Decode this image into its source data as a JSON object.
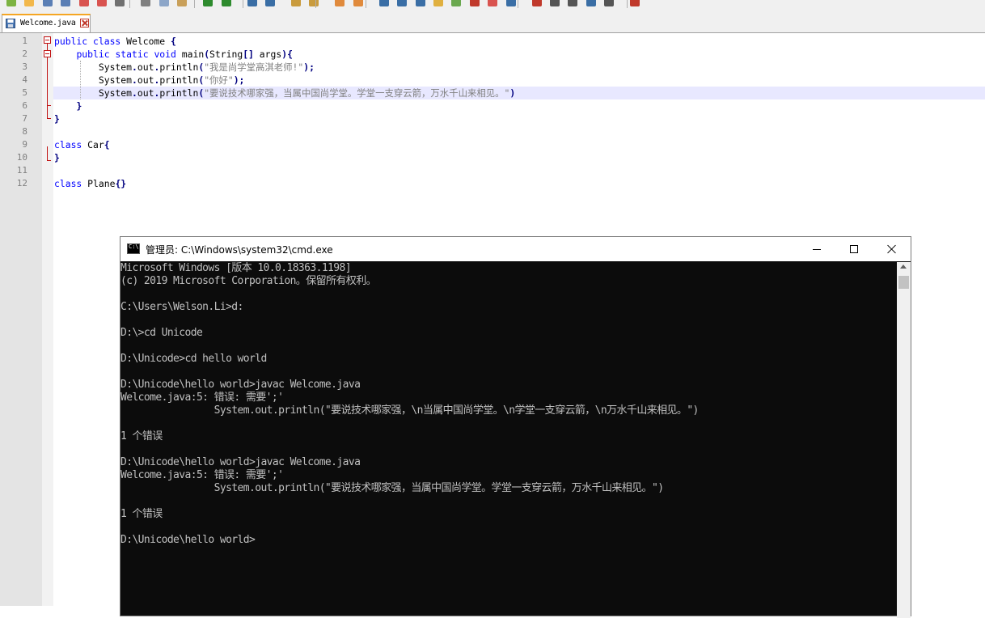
{
  "toolbar": {
    "buttons": [
      {
        "name": "new-file-icon",
        "color": "#7cb342"
      },
      {
        "name": "open-file-icon",
        "color": "#f2b84b"
      },
      {
        "name": "save-file-icon",
        "color": "#5b7fb5"
      },
      {
        "name": "save-all-icon",
        "color": "#5b7fb5"
      },
      {
        "name": "close-file-icon",
        "color": "#d9534f"
      },
      {
        "name": "close-all-icon",
        "color": "#d9534f"
      },
      {
        "name": "print-icon",
        "color": "#707070"
      },
      {
        "name": "cut-icon",
        "color": "#808080"
      },
      {
        "name": "copy-icon",
        "color": "#8da6c8"
      },
      {
        "name": "paste-icon",
        "color": "#c9a05a"
      },
      {
        "name": "undo-icon",
        "color": "#2e8b2e"
      },
      {
        "name": "redo-icon",
        "color": "#2e8b2e"
      },
      {
        "name": "find-icon",
        "color": "#3a6ea5"
      },
      {
        "name": "replace-icon",
        "color": "#3a6ea5"
      },
      {
        "name": "zoom-in-icon",
        "color": "#c99b3d"
      },
      {
        "name": "zoom-out-icon",
        "color": "#c99b3d"
      },
      {
        "name": "sync-v-icon",
        "color": "#e08a3c"
      },
      {
        "name": "sync-h-icon",
        "color": "#e08a3c"
      },
      {
        "name": "wrap-icon",
        "color": "#3a6ea5"
      },
      {
        "name": "all-chars-icon",
        "color": "#3a6ea5"
      },
      {
        "name": "indent-guide-icon",
        "color": "#3a6ea5"
      },
      {
        "name": "lang-icon",
        "color": "#e0b040"
      },
      {
        "name": "doc-map-icon",
        "color": "#6aa84f"
      },
      {
        "name": "function-list-icon",
        "color": "#c0392b"
      },
      {
        "name": "folder-workspace-icon",
        "color": "#d9534f"
      },
      {
        "name": "monitor-icon",
        "color": "#3a6ea5"
      },
      {
        "name": "record-macro-icon",
        "color": "#c0392b"
      },
      {
        "name": "stop-macro-icon",
        "color": "#555555"
      },
      {
        "name": "play-macro-icon",
        "color": "#555555"
      },
      {
        "name": "run-macro-icon",
        "color": "#3a6ea5"
      },
      {
        "name": "save-macro-icon",
        "color": "#555555"
      },
      {
        "name": "spell-check-icon",
        "color": "#c0392b"
      }
    ]
  },
  "tab": {
    "label": "Welcome.java"
  },
  "editor": {
    "line_numbers": [
      "1",
      "2",
      "3",
      "4",
      "5",
      "6",
      "7",
      "8",
      "9",
      "10",
      "11",
      "12"
    ],
    "lines": [
      [
        {
          "t": "public class",
          "c": "kw"
        },
        {
          "t": " Welcome ",
          "c": ""
        },
        {
          "t": "{",
          "c": "op"
        }
      ],
      [
        {
          "t": "    ",
          "c": ""
        },
        {
          "t": "public static void",
          "c": "kw"
        },
        {
          "t": " main",
          "c": ""
        },
        {
          "t": "(",
          "c": "op"
        },
        {
          "t": "String",
          "c": ""
        },
        {
          "t": "[]",
          "c": "op"
        },
        {
          "t": " args",
          "c": ""
        },
        {
          "t": "){",
          "c": "op"
        }
      ],
      [
        {
          "t": "        System",
          "c": ""
        },
        {
          "t": ".",
          "c": "op"
        },
        {
          "t": "out",
          "c": ""
        },
        {
          "t": ".",
          "c": "op"
        },
        {
          "t": "println",
          "c": ""
        },
        {
          "t": "(",
          "c": "op"
        },
        {
          "t": "\"我是尚学堂高淇老师!\"",
          "c": "str"
        },
        {
          "t": ");",
          "c": "op"
        }
      ],
      [
        {
          "t": "        System",
          "c": ""
        },
        {
          "t": ".",
          "c": "op"
        },
        {
          "t": "out",
          "c": ""
        },
        {
          "t": ".",
          "c": "op"
        },
        {
          "t": "println",
          "c": ""
        },
        {
          "t": "(",
          "c": "op"
        },
        {
          "t": "\"你好\"",
          "c": "str"
        },
        {
          "t": ");",
          "c": "op"
        }
      ],
      [
        {
          "t": "        System",
          "c": ""
        },
        {
          "t": ".",
          "c": "op"
        },
        {
          "t": "out",
          "c": ""
        },
        {
          "t": ".",
          "c": "op"
        },
        {
          "t": "println",
          "c": ""
        },
        {
          "t": "(",
          "c": "op"
        },
        {
          "t": "\"要说技术哪家强，当属中国尚学堂。学堂一支穿云箭，万水千山来相见。\"",
          "c": "str"
        },
        {
          "t": ")",
          "c": "op"
        }
      ],
      [
        {
          "t": "    ",
          "c": ""
        },
        {
          "t": "}",
          "c": "op"
        }
      ],
      [
        {
          "t": "}",
          "c": "op"
        }
      ],
      [],
      [
        {
          "t": "class",
          "c": "kw"
        },
        {
          "t": " Car",
          "c": ""
        },
        {
          "t": "{",
          "c": "op"
        }
      ],
      [
        {
          "t": "}",
          "c": "op"
        }
      ],
      [],
      [
        {
          "t": "class",
          "c": "kw"
        },
        {
          "t": " Plane",
          "c": ""
        },
        {
          "t": "{}",
          "c": "op"
        }
      ]
    ]
  },
  "cmd": {
    "title": "管理员: C:\\Windows\\system32\\cmd.exe",
    "lines": [
      "Microsoft Windows [版本 10.0.18363.1198]",
      "(c) 2019 Microsoft Corporation。保留所有权利。",
      "",
      "C:\\Users\\Welson.Li>d:",
      "",
      "D:\\>cd Unicode",
      "",
      "D:\\Unicode>cd hello world",
      "",
      "D:\\Unicode\\hello world>javac Welcome.java",
      "Welcome.java:5: 错误: 需要';'",
      "                System.out.println(\"要说技术哪家强，\\n当属中国尚学堂。\\n学堂一支穿云箭，\\n万水千山来相见。\")",
      "",
      "1 个错误",
      "",
      "D:\\Unicode\\hello world>javac Welcome.java",
      "Welcome.java:5: 错误: 需要';'",
      "                System.out.println(\"要说技术哪家强，当属中国尚学堂。学堂一支穿云箭，万水千山来相见。\")",
      "",
      "1 个错误",
      "",
      "D:\\Unicode\\hello world>"
    ]
  }
}
